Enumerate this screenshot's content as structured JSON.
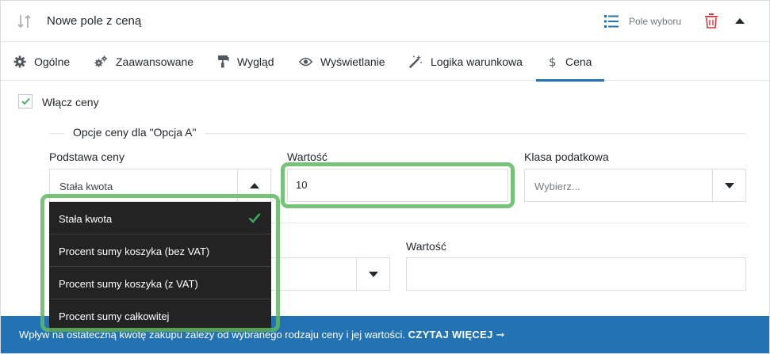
{
  "header": {
    "title": "Nowe pole z ceną",
    "field_type": "Pole wyboru"
  },
  "tabs": [
    {
      "label": "Ogólne",
      "icon": "gear-icon"
    },
    {
      "label": "Zaawansowane",
      "icon": "gears-icon"
    },
    {
      "label": "Wygląd",
      "icon": "paint-roller-icon"
    },
    {
      "label": "Wyświetlanie",
      "icon": "eye-icon"
    },
    {
      "label": "Logika warunkowa",
      "icon": "magic-wand-icon"
    },
    {
      "label": "Cena",
      "icon": "dollar-icon",
      "active": true
    }
  ],
  "enable_price": {
    "label": "Włącz ceny",
    "checked": true
  },
  "fieldset": {
    "legend": "Opcje ceny dla \"Opcja A\""
  },
  "price_base": {
    "label": "Podstawa ceny",
    "value": "Stała kwota",
    "options": [
      {
        "label": "Stała kwota",
        "selected": true
      },
      {
        "label": "Procent sumy koszyka (bez VAT)"
      },
      {
        "label": "Procent sumy koszyka (z VAT)"
      },
      {
        "label": "Procent sumy całkowitej"
      }
    ]
  },
  "value_field": {
    "label": "Wartość",
    "value": "10"
  },
  "tax_class": {
    "label": "Klasa podatkowa",
    "placeholder": "Wybierz..."
  },
  "second_row": {
    "value_label": "Wartość",
    "value": ""
  },
  "banner": {
    "text": "Wpływ na ostateczną kwotę zakupu zależy od wybranego rodzaju ceny i jej wartości.",
    "link_label": "CZYTAJ WIĘCEJ ➞"
  },
  "colors": {
    "accent": "#2271b1",
    "banner": "#2272b4",
    "highlight": "#5fb760",
    "danger": "#d63638",
    "dropdown_bg": "#232323"
  }
}
